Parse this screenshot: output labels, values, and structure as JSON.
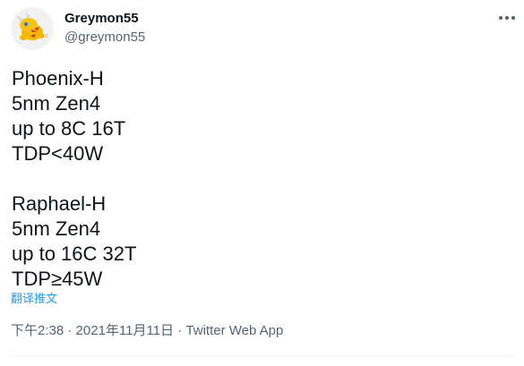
{
  "user": {
    "display_name": "Greymon55",
    "handle": "@greymon55",
    "avatar_icon": "digimon-avatar-icon"
  },
  "tweet": {
    "lines": [
      "Phoenix-H",
      "5nm Zen4",
      "up to 8C 16T",
      "TDP<40W",
      "",
      "Raphael-H",
      "5nm Zen4",
      "up to 16C 32T",
      "TDP≥45W"
    ],
    "translate_label": "翻译推文"
  },
  "meta": {
    "time": "下午2:38",
    "separator": " · ",
    "date": "2021年11月11日",
    "source": "Twitter Web App"
  },
  "colors": {
    "text": "#0f1419",
    "secondary": "#536471",
    "link": "#1d9bf0"
  }
}
